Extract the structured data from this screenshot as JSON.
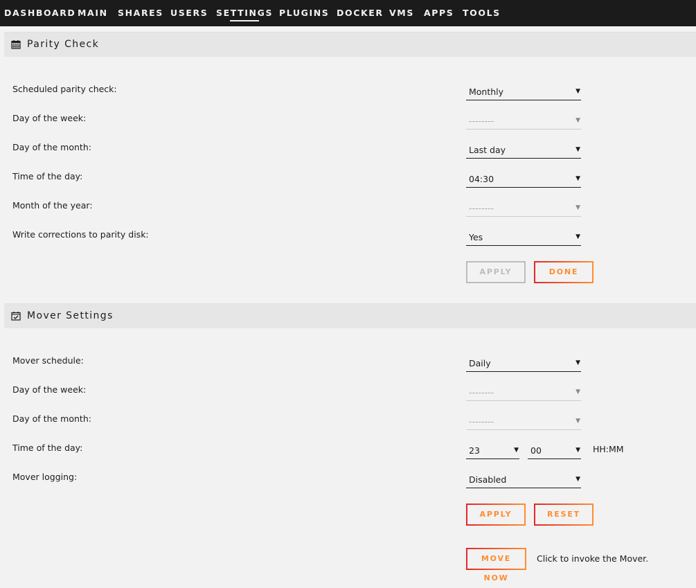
{
  "nav": {
    "items": [
      "DASHBOARD",
      "MAIN",
      "SHARES",
      "USERS",
      "SETTINGS",
      "PLUGINS",
      "DOCKER",
      "VMS",
      "APPS",
      "TOOLS"
    ],
    "active": "SETTINGS"
  },
  "parity": {
    "title": "Parity Check",
    "icon": "calendar-icon",
    "rows": [
      {
        "label": "Scheduled parity check:",
        "value": "Monthly",
        "disabled": false
      },
      {
        "label": "Day of the week:",
        "value": "--------",
        "disabled": true
      },
      {
        "label": "Day of the month:",
        "value": "Last day",
        "disabled": false
      },
      {
        "label": "Time of the day:",
        "value": "04:30",
        "disabled": false
      },
      {
        "label": "Month of the year:",
        "value": "--------",
        "disabled": true
      },
      {
        "label": "Write corrections to parity disk:",
        "value": "Yes",
        "disabled": false
      }
    ],
    "apply_label": "APPLY",
    "apply_disabled": true,
    "done_label": "DONE"
  },
  "mover": {
    "title": "Mover Settings",
    "icon": "calendar-check-icon",
    "rows": [
      {
        "label": "Mover schedule:",
        "value": "Daily",
        "disabled": false
      },
      {
        "label": "Day of the week:",
        "value": "--------",
        "disabled": true
      },
      {
        "label": "Day of the month:",
        "value": "--------",
        "disabled": true
      }
    ],
    "time_label": "Time of the day:",
    "time_hour": "23",
    "time_minute": "00",
    "time_format": "HH:MM",
    "logging_label": "Mover logging:",
    "logging_value": "Disabled",
    "apply_label": "APPLY",
    "reset_label": "RESET",
    "move_now_label": "MOVE NOW",
    "move_now_hint": "Click to invoke the Mover."
  },
  "colors": {
    "nav_bg": "#1c1b1b",
    "accent_orange": "#ff8c2f",
    "accent_red": "#e22828",
    "page_bg": "#f2f2f2"
  }
}
